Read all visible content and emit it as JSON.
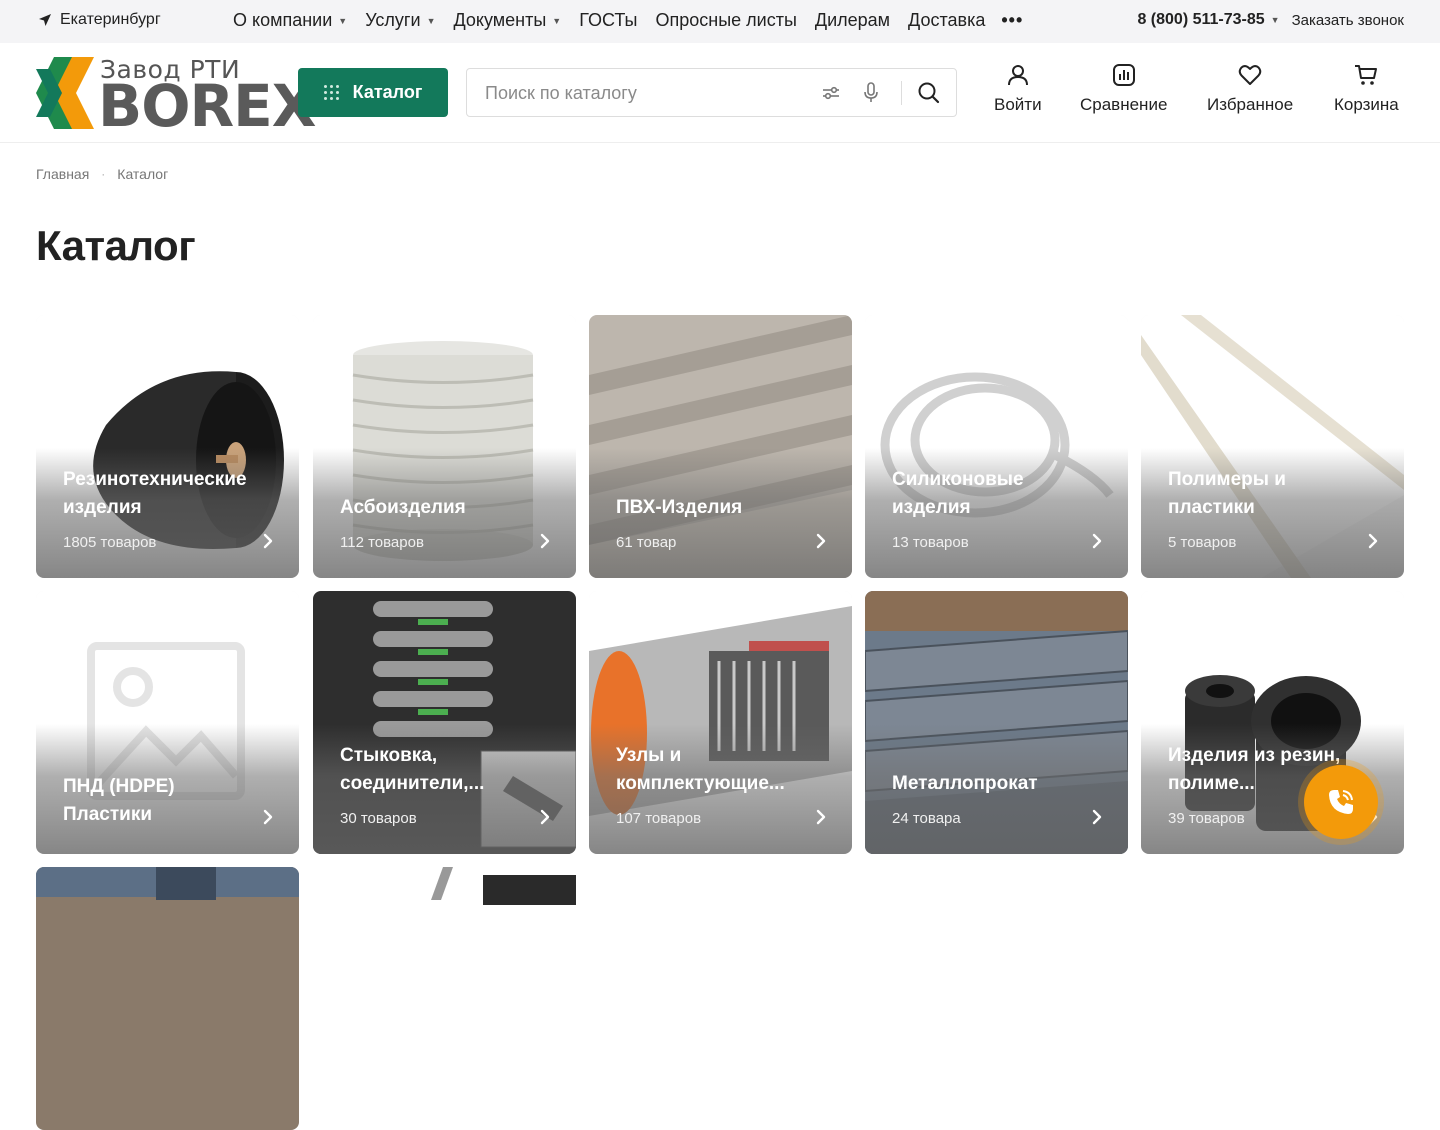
{
  "topbar": {
    "city": "Екатеринбург",
    "nav": [
      {
        "label": "О компании",
        "has_caret": true
      },
      {
        "label": "Услуги",
        "has_caret": true
      },
      {
        "label": "Документы",
        "has_caret": true
      },
      {
        "label": "ГОСТы",
        "has_caret": false
      },
      {
        "label": "Опросные листы",
        "has_caret": false
      },
      {
        "label": "Дилерам",
        "has_caret": false
      },
      {
        "label": "Доставка",
        "has_caret": false
      }
    ],
    "more": "•••",
    "phone": "8 (800) 511-73-85",
    "callback": "Заказать звонок"
  },
  "header": {
    "logo_sub": "Завод РТИ",
    "logo_main": "BOREX",
    "catalog_button": "Каталог",
    "search_placeholder": "Поиск по каталогу",
    "actions": {
      "login": "Войти",
      "compare": "Сравнение",
      "favorites": "Избранное",
      "cart": "Корзина"
    }
  },
  "breadcrumb": [
    "Главная",
    "Каталог"
  ],
  "page_title": "Каталог",
  "categories": [
    {
      "title": "Резинотехнические изделия",
      "count": "1805 товаров"
    },
    {
      "title": "Асбоизделия",
      "count": "112 товаров"
    },
    {
      "title": "ПВХ-Изделия",
      "count": "61 товар"
    },
    {
      "title": "Силиконовые изделия",
      "count": "13 товаров"
    },
    {
      "title": "Полимеры и пластики",
      "count": "5 товаров"
    },
    {
      "title": "ПНД (HDPE) Пластики",
      "count": ""
    },
    {
      "title": "Стыковка, соединители,...",
      "count": "30 товаров"
    },
    {
      "title": "Узлы и комплектующие...",
      "count": "107 товаров"
    },
    {
      "title": "Металлопрокат",
      "count": "24 товара"
    },
    {
      "title": "Изделия из резин, полиме...",
      "count": "39 товаров"
    }
  ],
  "colors": {
    "brand_green": "#13795b",
    "brand_orange": "#f39a0a",
    "logo_gray": "#5a5a5a"
  }
}
